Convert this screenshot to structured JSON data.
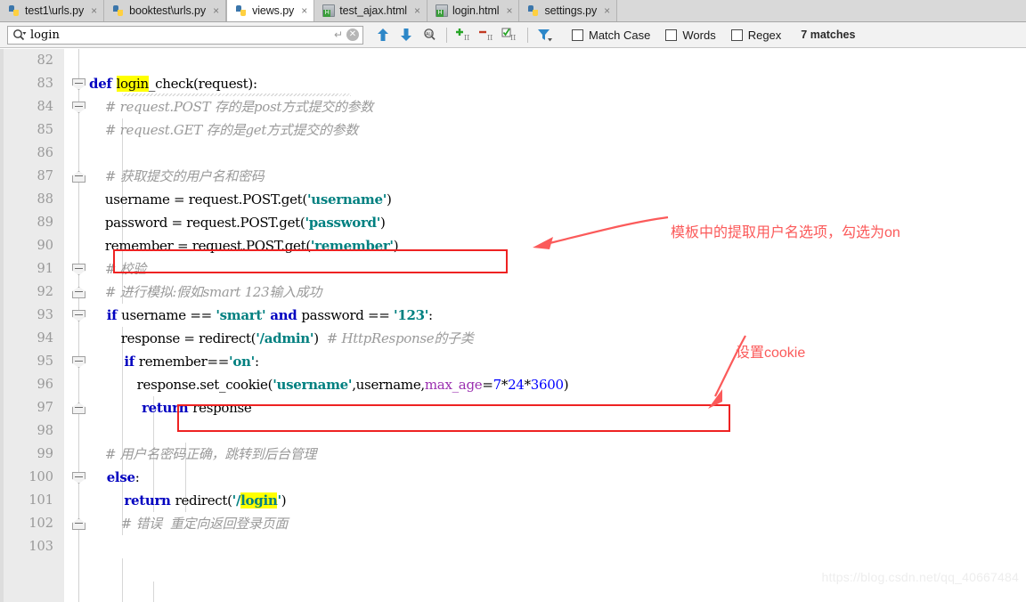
{
  "tabs": [
    {
      "label": "test1\\urls.py",
      "icon": "python-file-icon",
      "active": false,
      "close": "×"
    },
    {
      "label": "booktest\\urls.py",
      "icon": "python-file-icon",
      "active": false,
      "close": "×"
    },
    {
      "label": "views.py",
      "icon": "python-file-icon",
      "active": true,
      "close": "×"
    },
    {
      "label": "test_ajax.html",
      "icon": "html-file-icon",
      "active": false,
      "close": "×"
    },
    {
      "label": "login.html",
      "icon": "html-file-icon",
      "active": false,
      "close": "×"
    },
    {
      "label": "settings.py",
      "icon": "python-file-icon",
      "active": false,
      "close": "×"
    }
  ],
  "search": {
    "value": "login",
    "placeholder": "Search",
    "magnifier_icon": "search-icon",
    "dropdown_icon": "chevron-down-icon",
    "enter_icon": "↵",
    "clear_icon": "✕",
    "toolbar_icons": [
      "arrow-up-icon",
      "arrow-down-icon",
      "find-all-icon",
      "select-all-occurrences-icon",
      "remove-occurrence-icon",
      "select-occurrence-icon",
      "filter-icon"
    ],
    "options": [
      {
        "label": "Match Case",
        "accel": "C",
        "checked": false
      },
      {
        "label": "Words",
        "accel": "r",
        "checked": false
      },
      {
        "label": "Regex",
        "accel": "g",
        "checked": false
      }
    ],
    "matches": "7 matches"
  },
  "editor": {
    "language": "python",
    "first_line": 82,
    "lines": [
      {
        "n": "82",
        "fold": "none",
        "tokens": []
      },
      {
        "n": "83",
        "fold": "start",
        "tokens": [
          {
            "t": "def ",
            "c": "kw"
          },
          {
            "t": "login",
            "c": "plain hl"
          },
          {
            "t": "_check",
            "c": "plain"
          },
          {
            "t": "(request):",
            "c": "plain"
          }
        ]
      },
      {
        "n": "84",
        "fold": "start",
        "tokens": [
          {
            "t": "    # request.POST 存的是post方式提交的参数",
            "c": "cmt"
          }
        ]
      },
      {
        "n": "85",
        "fold": "none",
        "tokens": [
          {
            "t": "    # request.GET 存的是get方式提交的参数",
            "c": "cmt"
          }
        ]
      },
      {
        "n": "86",
        "fold": "none",
        "tokens": []
      },
      {
        "n": "87",
        "fold": "end",
        "tokens": [
          {
            "t": "    # 获取提交的用户名和密码",
            "c": "cmt"
          }
        ]
      },
      {
        "n": "88",
        "fold": "none",
        "tokens": [
          {
            "t": "    username = request.POST.get(",
            "c": "plain"
          },
          {
            "t": "'username'",
            "c": "str"
          },
          {
            "t": ")",
            "c": "plain"
          }
        ]
      },
      {
        "n": "89",
        "fold": "none",
        "tokens": [
          {
            "t": "    password = request.POST.get(",
            "c": "plain"
          },
          {
            "t": "'password'",
            "c": "str"
          },
          {
            "t": ")",
            "c": "plain"
          }
        ]
      },
      {
        "n": "90",
        "fold": "none",
        "tokens": [
          {
            "t": "    remember = request.POST.get(",
            "c": "plain"
          },
          {
            "t": "'remember'",
            "c": "str"
          },
          {
            "t": ")",
            "c": "plain"
          }
        ]
      },
      {
        "n": "91",
        "fold": "start",
        "tokens": [
          {
            "t": "    # 校验",
            "c": "cmt"
          }
        ]
      },
      {
        "n": "92",
        "fold": "end",
        "tokens": [
          {
            "t": "    # 进行模拟:假如smart 123输入成功",
            "c": "cmt"
          }
        ]
      },
      {
        "n": "93",
        "fold": "start",
        "tokens": [
          {
            "t": "    if ",
            "c": "kw"
          },
          {
            "t": "username == ",
            "c": "plain"
          },
          {
            "t": "'smart'",
            "c": "str"
          },
          {
            "t": " and ",
            "c": "kw"
          },
          {
            "t": "password == ",
            "c": "plain"
          },
          {
            "t": "'123'",
            "c": "str"
          },
          {
            "t": ":",
            "c": "plain"
          }
        ]
      },
      {
        "n": "94",
        "fold": "none",
        "tokens": [
          {
            "t": "        response = redirect(",
            "c": "plain"
          },
          {
            "t": "'/admin'",
            "c": "str"
          },
          {
            "t": ")  ",
            "c": "plain"
          },
          {
            "t": "# HttpResponse的子类",
            "c": "cmt"
          }
        ]
      },
      {
        "n": "95",
        "fold": "start",
        "tokens": [
          {
            "t": "        if ",
            "c": "kw"
          },
          {
            "t": "remember==",
            "c": "plain"
          },
          {
            "t": "'on'",
            "c": "str"
          },
          {
            "t": ":",
            "c": "plain"
          }
        ]
      },
      {
        "n": "96",
        "fold": "none",
        "tokens": [
          {
            "t": "            response.set_cookie(",
            "c": "plain"
          },
          {
            "t": "'username'",
            "c": "str"
          },
          {
            "t": ",username,",
            "c": "plain"
          },
          {
            "t": "max_age",
            "c": "kwarg"
          },
          {
            "t": "=",
            "c": "plain"
          },
          {
            "t": "7",
            "c": "num"
          },
          {
            "t": "*",
            "c": "plain"
          },
          {
            "t": "24",
            "c": "num"
          },
          {
            "t": "*",
            "c": "plain"
          },
          {
            "t": "3600",
            "c": "num"
          },
          {
            "t": ")",
            "c": "plain"
          }
        ]
      },
      {
        "n": "97",
        "fold": "end",
        "tokens": [
          {
            "t": "            return ",
            "c": "kw"
          },
          {
            "t": "response",
            "c": "plain"
          }
        ]
      },
      {
        "n": "98",
        "fold": "none",
        "tokens": []
      },
      {
        "n": "99",
        "fold": "none",
        "tokens": [
          {
            "t": "    # 用户名密码正确，跳转到后台管理",
            "c": "cmt"
          }
        ]
      },
      {
        "n": "100",
        "fold": "start",
        "tokens": [
          {
            "t": "    else",
            "c": "kw"
          },
          {
            "t": ":",
            "c": "plain"
          }
        ]
      },
      {
        "n": "101",
        "fold": "none",
        "tokens": [
          {
            "t": "        return ",
            "c": "kw"
          },
          {
            "t": "redirect(",
            "c": "plain"
          },
          {
            "t": "'/",
            "c": "str"
          },
          {
            "t": "login",
            "c": "str hl"
          },
          {
            "t": "'",
            "c": "str"
          },
          {
            "t": ")",
            "c": "plain"
          }
        ]
      },
      {
        "n": "102",
        "fold": "end",
        "tokens": [
          {
            "t": "        # 错误  重定向返回登录页面",
            "c": "cmt"
          }
        ]
      },
      {
        "n": "103",
        "fold": "none",
        "tokens": []
      }
    ]
  },
  "annotations": [
    {
      "id": "remember-note",
      "text": "模板中的提取用户名选项，勾选为on",
      "color": "#fb5a5a",
      "arrow": "left-arrow-icon"
    },
    {
      "id": "cookie-note",
      "text": "设置cookie",
      "color": "#fb5a5a",
      "arrow": "down-left-arrow-icon"
    }
  ],
  "highlight_boxes": [
    {
      "id": "remember-line-box",
      "color": "#ee2222"
    },
    {
      "id": "set-cookie-line-box",
      "color": "#ee2222"
    }
  ],
  "watermark": "https://blog.csdn.net/qq_40667484"
}
